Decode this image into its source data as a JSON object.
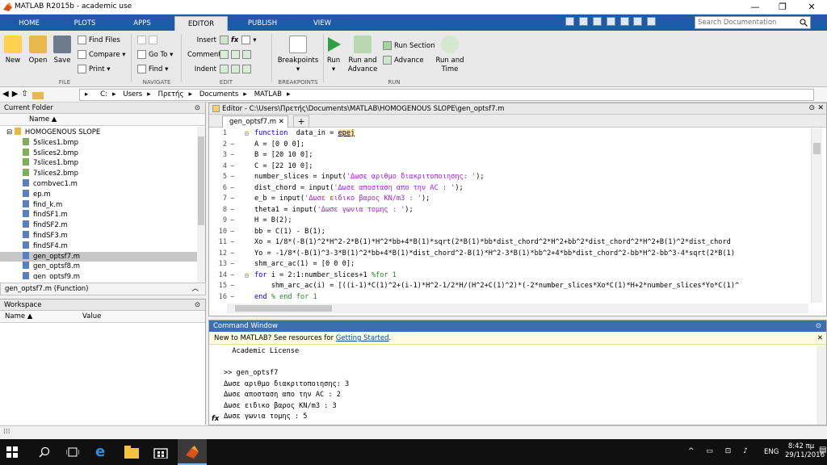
{
  "window": {
    "title": "MATLAB R2015b - academic use"
  },
  "tabs": [
    "HOME",
    "PLOTS",
    "APPS",
    "EDITOR",
    "PUBLISH",
    "VIEW"
  ],
  "search": {
    "placeholder": "Search Documentation"
  },
  "toolstrip": {
    "file": {
      "new": "New",
      "open": "Open",
      "save": "Save",
      "find_files": "Find Files",
      "compare": "Compare",
      "print": "Print",
      "group": "FILE"
    },
    "navigate": {
      "goto": "Go To",
      "find": "Find",
      "group": "NAVIGATE"
    },
    "edit": {
      "insert": "Insert",
      "comment": "Comment",
      "indent": "Indent",
      "fx": "fx",
      "group": "EDIT"
    },
    "breakpoints": {
      "label": "Breakpoints",
      "group": "BREAKPOINTS"
    },
    "run": {
      "run": "Run",
      "run_advance_1": "Run and",
      "run_advance_2": "Advance",
      "run_section": "Run Section",
      "advance": "Advance",
      "run_time_1": "Run and",
      "run_time_2": "Time",
      "group": "RUN"
    }
  },
  "path": [
    "C:",
    "Users",
    "Πρετής",
    "Documents",
    "MATLAB"
  ],
  "current_folder": {
    "title": "Current Folder",
    "column": "Name",
    "folder": "HOMOGENOUS SLOPE",
    "files": [
      "5slices1.bmp",
      "5slices2.bmp",
      "7slices1.bmp",
      "7slices2.bmp",
      "combvec1.m",
      "ep.m",
      "find_k.m",
      "findSF1.m",
      "findSF2.m",
      "findSF3.m",
      "findSF4.m",
      "gen_optsf7.m",
      "gen_optsf8.m",
      "gen_optsf9.m"
    ],
    "selected": "gen_optsf7.m",
    "details": "gen_optsf7.m  (Function)"
  },
  "workspace": {
    "title": "Workspace",
    "col_name": "Name",
    "col_value": "Value"
  },
  "editor": {
    "title": "Editor - C:\\Users\\Πρετής\\Documents\\MATLAB\\HOMOGENOUS SLOPE\\gen_optsf7.m",
    "tab": "gen_optsf7.m",
    "plus": "+",
    "lines": [
      {
        "n": "1",
        "d": "",
        "f": "⊟",
        "parts": [
          [
            "kw",
            "function"
          ],
          [
            "",
            "  data_in = "
          ],
          [
            "fn",
            "epej"
          ]
        ]
      },
      {
        "n": "2",
        "d": "−",
        "f": "",
        "parts": [
          [
            "",
            "A = [0 0 0];"
          ]
        ]
      },
      {
        "n": "3",
        "d": "−",
        "f": "",
        "parts": [
          [
            "",
            "B = [20 10 0];"
          ]
        ]
      },
      {
        "n": "4",
        "d": "−",
        "f": "",
        "parts": [
          [
            "",
            "C = [22 10 0];"
          ]
        ]
      },
      {
        "n": "5",
        "d": "−",
        "f": "",
        "parts": [
          [
            "",
            "number_slices = input("
          ],
          [
            "str",
            "'Δωσε αριθμο διακριτοποιησης: '"
          ],
          [
            "",
            ");"
          ]
        ]
      },
      {
        "n": "6",
        "d": "−",
        "f": "",
        "parts": [
          [
            "",
            "dist_chord = input("
          ],
          [
            "str",
            "'Δωσε αποσταση απο την AC : '"
          ],
          [
            "",
            ");"
          ]
        ]
      },
      {
        "n": "7",
        "d": "−",
        "f": "",
        "parts": [
          [
            "",
            "e_b = input("
          ],
          [
            "str",
            "'Δωσε ειδικο βαρος KN/m3 : '"
          ],
          [
            "",
            ");"
          ]
        ]
      },
      {
        "n": "8",
        "d": "−",
        "f": "",
        "parts": [
          [
            "",
            "theta1 = input("
          ],
          [
            "str",
            "'Δωσε γωνια τομης : '"
          ],
          [
            "",
            ");"
          ]
        ]
      },
      {
        "n": "9",
        "d": "−",
        "f": "",
        "parts": [
          [
            "",
            "H = B(2);"
          ]
        ]
      },
      {
        "n": "10",
        "d": "−",
        "f": "",
        "parts": [
          [
            "",
            "bb = C(1) - B(1);"
          ]
        ]
      },
      {
        "n": "11",
        "d": "−",
        "f": "",
        "parts": [
          [
            "",
            "Xo = 1/8*(-B(1)^2*H^2-2*B(1)*H^2*bb+4*B(1)*sqrt(2*B(1)*bb*dist_chord^2*H^2+bb^2*dist_chord^2*H^2+B(1)^2*dist_chord"
          ]
        ]
      },
      {
        "n": "12",
        "d": "−",
        "f": "",
        "parts": [
          [
            "",
            "Yo = -1/8*(-B(1)^3-3*B(1)^2*bb+4*B(1)*dist_chord^2-B(1)*H^2-3*B(1)*bb^2+4*bb*dist_chord^2-bb*H^2-bb^3-4*sqrt(2*B(1)"
          ]
        ]
      },
      {
        "n": "13",
        "d": "−",
        "f": "",
        "parts": [
          [
            "",
            "shm_arc_ac(1) = [0 0 0];"
          ]
        ]
      },
      {
        "n": "14",
        "d": "−",
        "f": "⊟",
        "parts": [
          [
            "kw",
            "for"
          ],
          [
            "",
            " i = 2:1:number_slices+1 "
          ],
          [
            "cm",
            "%for 1"
          ]
        ]
      },
      {
        "n": "15",
        "d": "−",
        "f": "",
        "parts": [
          [
            "",
            "    shm_arc_ac(i) = [((i-1)*C(1)^2+(i-1)*H^2-1/2*H/(H^2+C(1)^2)*(-2*number_slices*Xo*C(1)*H+2*number_slices*Yo*C(1)^"
          ]
        ]
      },
      {
        "n": "16",
        "d": "−",
        "f": "",
        "parts": [
          [
            "kw",
            "end"
          ],
          [
            "cm",
            " % end for 1"
          ]
        ]
      }
    ]
  },
  "command_window": {
    "title": "Command Window",
    "new_text": "New to MATLAB? See resources for ",
    "new_link": "Getting Started",
    "new_end": ".",
    "lines": [
      "  Academic License",
      "",
      ">> gen_optsf7",
      "Δωσε αριθμο διακριτοποιησης: 3",
      "Δωσε αποσταση απο την AC : 2",
      "Δωσε ειδικο βαρος KN/m3 : 3",
      "Δωσε γωνια τομης : 5"
    ],
    "fx": "fx"
  },
  "taskbar": {
    "lang": "ENG",
    "time": "8:42 πμ",
    "date": "29/11/2016"
  },
  "colors": {
    "tabbar": "#1e5aa8",
    "cmdhead": "#3b6fb0",
    "selected_row": "#c6c6c6"
  }
}
